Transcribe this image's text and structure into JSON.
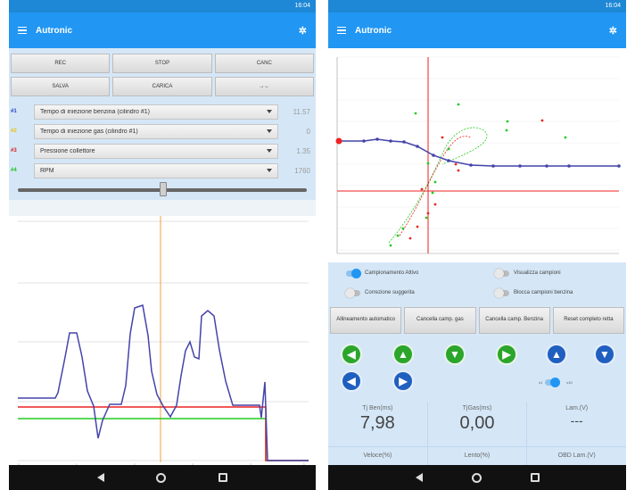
{
  "left": {
    "status_time": "16:04",
    "app_title": "Autronic",
    "buttons_row1": [
      "REC",
      "STOP",
      "CANC"
    ],
    "buttons_row2": [
      "SALVA",
      "CARICA",
      "→←"
    ],
    "channels": [
      {
        "num": "#1",
        "label": "Tempo di iniezione benzina (cilindro #1)",
        "value": "11.57",
        "color": "#1f3fbf"
      },
      {
        "num": "#2",
        "label": "Tempo di iniezione gas (cilindro #1)",
        "value": "0",
        "color": "#e8c000"
      },
      {
        "num": "#3",
        "label": "Pressione collettore",
        "value": "1.35",
        "color": "#d81c1c"
      },
      {
        "num": "#4",
        "label": "RPM",
        "value": "1760",
        "color": "#1fbf1f"
      }
    ],
    "slider_value": 0.5,
    "colors": {
      "blue": "#4444aa",
      "red": "#ee2222",
      "green": "#22cc22",
      "orange": "#f0a040"
    }
  },
  "right": {
    "status_time": "16:04",
    "app_title": "Autronic",
    "toggles": [
      {
        "label": "Campionamento Attivo",
        "on": true
      },
      {
        "label": "Visualizza campioni",
        "on": false
      },
      {
        "label": "Correzione suggerita",
        "on": false
      },
      {
        "label": "Blocca campioni benzina",
        "on": false
      }
    ],
    "actions": [
      "Allineamento automatico",
      "Cancella camp. gas",
      "Cancella camp. Benzina",
      "Reset completo retta"
    ],
    "mini_toggle": {
      "left": "x1",
      "right": "x10",
      "on": true
    },
    "readouts": [
      {
        "label": "Tj Ben(ms)",
        "value": "7,98"
      },
      {
        "label": "TjGas(ms)",
        "value": "0,00"
      },
      {
        "label": "Lam.(V)",
        "value": "---"
      }
    ],
    "bottom_labels": [
      "Veloce(%)",
      "Lento(%)",
      "OBD Lam.(V)"
    ],
    "icons": [
      "arrow-left-icon",
      "arrow-up-icon",
      "arrow-down-icon",
      "arrow-right-icon",
      "zoom-in-icon",
      "zoom-out-icon",
      "skip-left-icon",
      "skip-right-icon"
    ]
  }
}
